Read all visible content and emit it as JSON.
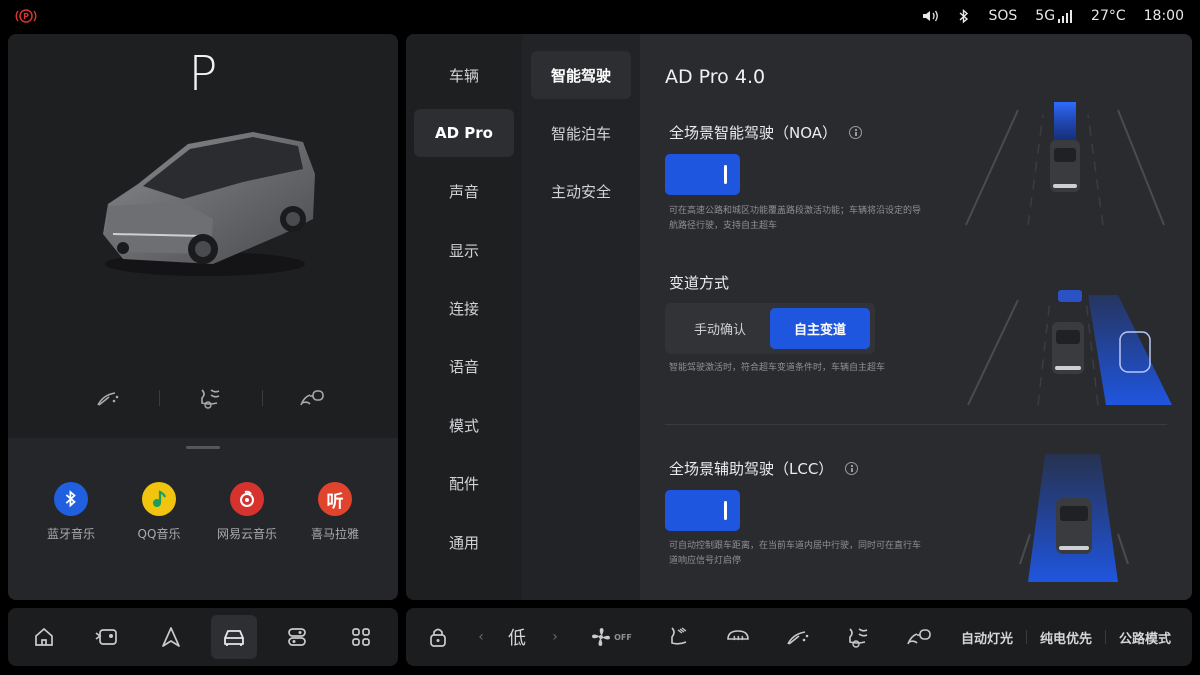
{
  "status_bar": {
    "sos": "SOS",
    "signal": "5G",
    "temperature": "27°C",
    "time": "18:00",
    "icons": [
      "parking-brake-icon",
      "volume-icon",
      "bluetooth-icon",
      "signal-bars-icon"
    ],
    "parking_color": "#d8362f"
  },
  "left_panel": {
    "gear": "P",
    "quick_icons": [
      "wiper-icon",
      "seat-heat-icon",
      "mirror-fold-icon"
    ],
    "media_apps": [
      {
        "label": "蓝牙音乐",
        "icon": "bluetooth-music-icon",
        "color": "#1f5fe0"
      },
      {
        "label": "QQ音乐",
        "icon": "qq-music-icon",
        "color": "#f1c40f"
      },
      {
        "label": "网易云音乐",
        "icon": "netease-music-icon",
        "color": "#d6332f"
      },
      {
        "label": "喜马拉雅",
        "icon": "ximalaya-icon",
        "color": "#e0442c",
        "glyph": "听"
      }
    ]
  },
  "settings": {
    "nav_primary": [
      "车辆",
      "AD Pro",
      "声音",
      "显示",
      "连接",
      "语音",
      "模式",
      "配件",
      "通用"
    ],
    "nav_primary_active": "AD Pro",
    "nav_secondary": [
      "智能驾驶",
      "智能泊车",
      "主动安全"
    ],
    "nav_secondary_active": "智能驾驶",
    "title": "AD Pro 4.0",
    "noa": {
      "title": "全场景智能驾驶（NOA）",
      "enabled": true,
      "desc": "可在高速公路和城区功能覆盖路段激活功能；车辆将沿设定的导航路径行驶，支持自主超车"
    },
    "lane_change": {
      "title": "变道方式",
      "options": [
        "手动确认",
        "自主变道"
      ],
      "selected": "自主变道",
      "desc": "智能驾驶激活时，符合超车变道条件时，车辆自主超车"
    },
    "lcc": {
      "title": "全场景辅助驾驶（LCC）",
      "enabled": true,
      "desc": "可自动控制跟车距离，在当前车道内居中行驶，同时可在直行车道响应信号灯启停"
    },
    "accent_color": "#1f56e0"
  },
  "dock_left": {
    "items": [
      "home-icon",
      "media-icon",
      "navigation-icon",
      "car-icon",
      "controls-icon",
      "apps-icon"
    ],
    "active": "car-icon"
  },
  "dock_right": {
    "fan_level": "低",
    "fan_state": "OFF",
    "auto_light": "自动灯光",
    "ev_priority": "纯电优先",
    "road_mode": "公路模式",
    "icons": [
      "lock-icon",
      "fan-icon",
      "seat-ventilation-icon",
      "defrost-icon",
      "wiper-icon",
      "seat-heat-icon",
      "mirror-icon"
    ]
  }
}
